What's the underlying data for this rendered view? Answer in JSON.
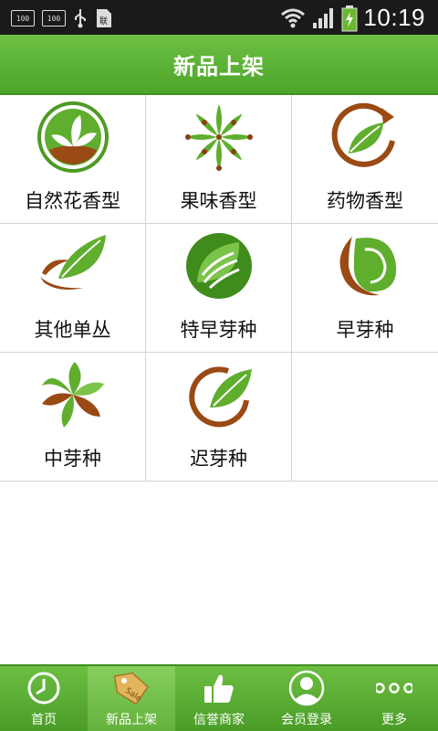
{
  "status": {
    "icons": [
      "battery-percent-icon",
      "battery-percent-icon",
      "usb-icon",
      "sim-card-icon",
      "wifi-icon",
      "signal-icon",
      "battery-charging-icon"
    ],
    "time": "10:19"
  },
  "header": {
    "title": "新品上架"
  },
  "categories": [
    {
      "label": "自然花香型",
      "icon": "leaf-ring-icon"
    },
    {
      "label": "果味香型",
      "icon": "leaf-flower-icon"
    },
    {
      "label": "药物香型",
      "icon": "leaf-arrow-ring-icon"
    },
    {
      "label": "其他单丛",
      "icon": "leaf-swoosh-icon"
    },
    {
      "label": "特早芽种",
      "icon": "leaf-circle-icon"
    },
    {
      "label": "早芽种",
      "icon": "leaf-crescent-icon"
    },
    {
      "label": "中芽种",
      "icon": "leaf-spiral-icon"
    },
    {
      "label": "迟芽种",
      "icon": "leaf-ring-brown-icon"
    }
  ],
  "tabs": [
    {
      "label": "首页",
      "icon": "clock-icon",
      "active": false
    },
    {
      "label": "新品上架",
      "icon": "sale-tag-icon",
      "active": true
    },
    {
      "label": "信誉商家",
      "icon": "thumbs-up-icon",
      "active": false
    },
    {
      "label": "会员登录",
      "icon": "user-icon",
      "active": false
    },
    {
      "label": "更多",
      "icon": "more-icon",
      "active": false
    }
  ],
  "colors": {
    "brand_green": "#4ea52a",
    "leaf_green": "#5fae2e",
    "earth_brown": "#9a4a14"
  }
}
